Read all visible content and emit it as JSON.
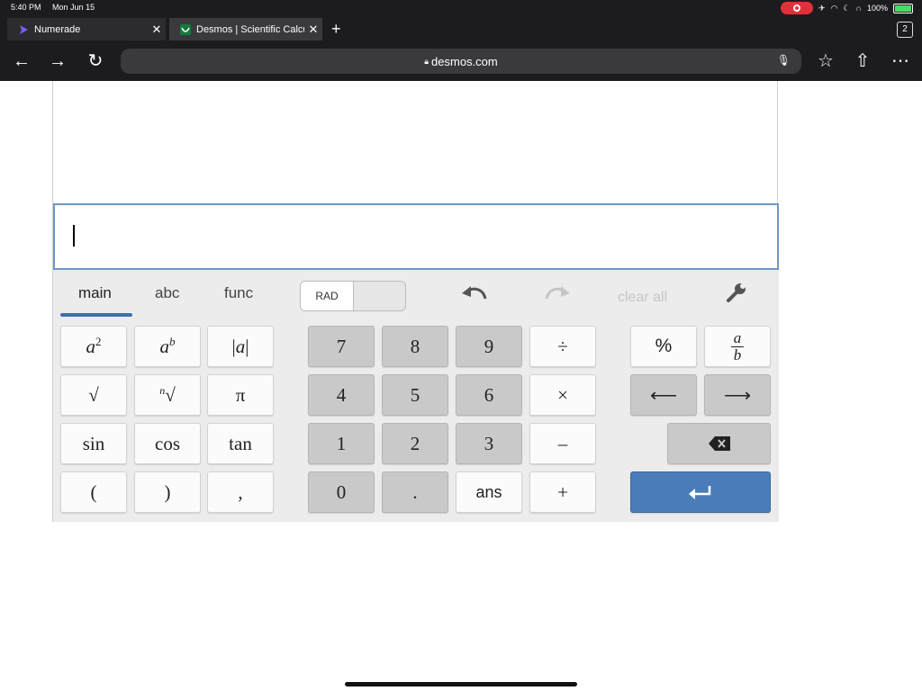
{
  "status": {
    "time": "5:40 PM",
    "date": "Mon Jun 15",
    "battery": "100%"
  },
  "browser": {
    "tabs": [
      {
        "title": "Numerade"
      },
      {
        "title": "Desmos | Scientific Calculator"
      }
    ],
    "tab_count": "2",
    "url": "desmos.com"
  },
  "calculator": {
    "keypad_tabs": [
      "main",
      "abc",
      "func"
    ],
    "angle_mode": "RAD",
    "clear_all": "clear all",
    "keys": {
      "sqrt": "√",
      "pi": "π",
      "sin": "sin",
      "cos": "cos",
      "tan": "tan",
      "lparen": "(",
      "rparen": ")",
      "comma": ",",
      "seven": "7",
      "eight": "8",
      "nine": "9",
      "four": "4",
      "five": "5",
      "six": "6",
      "one": "1",
      "two": "2",
      "three": "3",
      "zero": "0",
      "dot": ".",
      "ans": "ans",
      "divide": "÷",
      "times": "×",
      "minus": "–",
      "plus": "+",
      "percent": "%"
    }
  }
}
